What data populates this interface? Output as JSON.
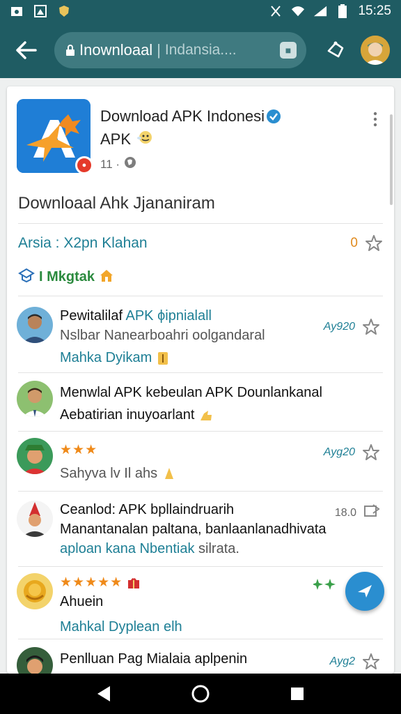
{
  "status_bar": {
    "time": "15:25",
    "icons": [
      "screenshot-icon",
      "gallery-icon",
      "shield-icon",
      "vibrate-icon",
      "wifi-icon",
      "signal-icon",
      "battery-icon"
    ]
  },
  "app_bar": {
    "url_text": "Inownloaal",
    "url_hint": "Indansia....",
    "colors": {
      "bar": "#1f5c63",
      "pill": "#3f7a80"
    }
  },
  "app": {
    "title": "Download APK Indonesi",
    "subtitle": "APK",
    "meta": "11 ·"
  },
  "section_title": "Downloaal Ahk Jjananiram",
  "stats": {
    "text": "Arsia : X2pn Klahan",
    "count": "0"
  },
  "tag": {
    "label": "I Mkgtak"
  },
  "reviews": [
    {
      "line1_a": "Pewitalilaf",
      "line1_b": "APK ϕipnialall",
      "line2": "Nslbar Nanearboahri oolgandaral",
      "line3": "Mahka Dyikam",
      "side": "Ay920"
    },
    {
      "line1": "Menwlal APK kebeulan APK Dounlankanal",
      "line2": "Aebatirian inuyoarlant"
    },
    {
      "stars": "★★★",
      "line2": "Sahyva lv Il ahs",
      "side": "Ayg20"
    },
    {
      "line1": "Ceanlod: APK bpllaindruarih",
      "line2": "Manantanalan paltana, banlaanlanadhivata",
      "line3_a": "aploan kana Nbentiak",
      "line3_b": "silrata.",
      "side": "18.0"
    },
    {
      "stars": "★★★★★",
      "line2": "Ahuein",
      "line3": "Mahkal Dyplean elh"
    },
    {
      "line1": "Penlluan Pag Mialaia aplpenin",
      "side": "Ayg2"
    }
  ],
  "accent_colors": {
    "link": "#1e7f95",
    "star": "#ef8a1a",
    "fab": "#2a8ed0"
  }
}
